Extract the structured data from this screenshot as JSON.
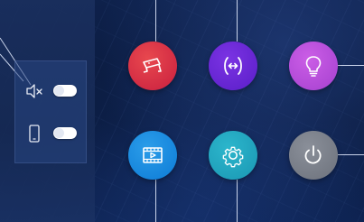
{
  "screen": {
    "panel": {
      "mute_toggle": {
        "icon": "speaker-mute-icon",
        "state": "on"
      },
      "phone_toggle": {
        "icon": "phone-icon",
        "state": "on"
      }
    },
    "buttons": [
      {
        "id": "camera",
        "icon": "cctv-camera-icon",
        "color": "#d32f45"
      },
      {
        "id": "intercom",
        "icon": "intercom-icon",
        "color": "#6a27d6"
      },
      {
        "id": "light",
        "icon": "lightbulb-icon",
        "color": "#b84fdb"
      },
      {
        "id": "media",
        "icon": "video-play-icon",
        "color": "#1a8be0"
      },
      {
        "id": "settings",
        "icon": "gear-icon",
        "color": "#21a6c0"
      },
      {
        "id": "power",
        "icon": "power-icon",
        "color": "#7a7f89"
      }
    ]
  }
}
